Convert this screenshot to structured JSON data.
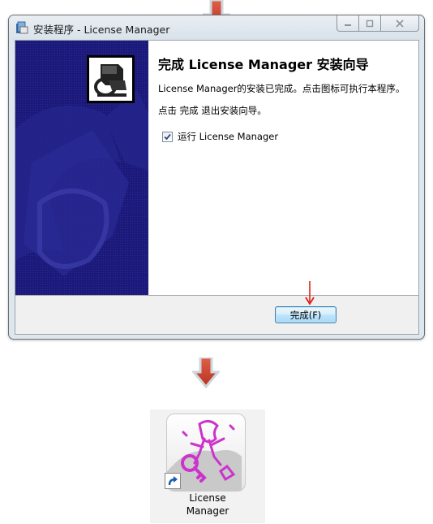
{
  "window": {
    "title": "安装程序 - License Manager",
    "heading": "完成 License Manager 安装向导",
    "line1": "License Manager的安装已完成。点击图标可执行本程序。",
    "line2": "点击 完成 退出安装向导。",
    "run_checkbox": {
      "label": "运行 License Manager",
      "checked": true
    },
    "finish_button": "完成(F)"
  },
  "shortcut": {
    "label_line1": "License",
    "label_line2": "Manager"
  },
  "colors": {
    "banner": "#1b1a7a",
    "guide_arrow": "#c0392b",
    "icon_accent": "#cc33cc"
  }
}
